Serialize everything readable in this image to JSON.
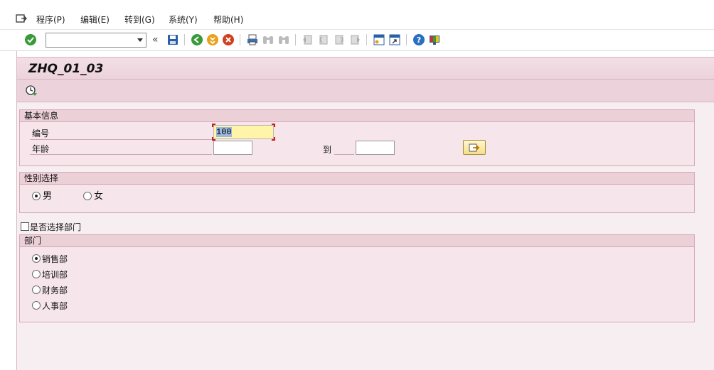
{
  "menu": {
    "items": [
      "程序(P)",
      "编辑(E)",
      "转到(G)",
      "系统(Y)",
      "帮助(H)"
    ]
  },
  "toolbar": {
    "command_value": "",
    "icons": [
      "enter-icon",
      "save-icon",
      "back-icon",
      "exit-icon",
      "cancel-icon",
      "print-icon",
      "find-icon",
      "find-next-icon",
      "first-page-icon",
      "previous-page-icon",
      "next-page-icon",
      "last-page-icon",
      "create-session-icon",
      "shortcut-icon",
      "help-icon",
      "customize-layout-icon"
    ]
  },
  "title": "ZHQ_01_03",
  "groups": {
    "basic": {
      "title": "基本信息",
      "id_label": "编号",
      "id_value": "100",
      "age_label": "年龄",
      "age_low": "",
      "to_label": "到",
      "age_high": ""
    },
    "gender": {
      "title": "性别选择",
      "options": [
        {
          "label": "男",
          "selected": true
        },
        {
          "label": "女",
          "selected": false
        }
      ]
    },
    "dept_checkbox": {
      "label": "是否选择部门",
      "checked": false
    },
    "department": {
      "title": "部门",
      "options": [
        {
          "label": "销售部",
          "selected": true
        },
        {
          "label": "培训部",
          "selected": false
        },
        {
          "label": "财务部",
          "selected": false
        },
        {
          "label": "人事部",
          "selected": false
        }
      ]
    }
  },
  "colors": {
    "accent_pink": "#ecd0d8",
    "input_highlight": "#fff4a8",
    "focus_red": "#d01818"
  }
}
